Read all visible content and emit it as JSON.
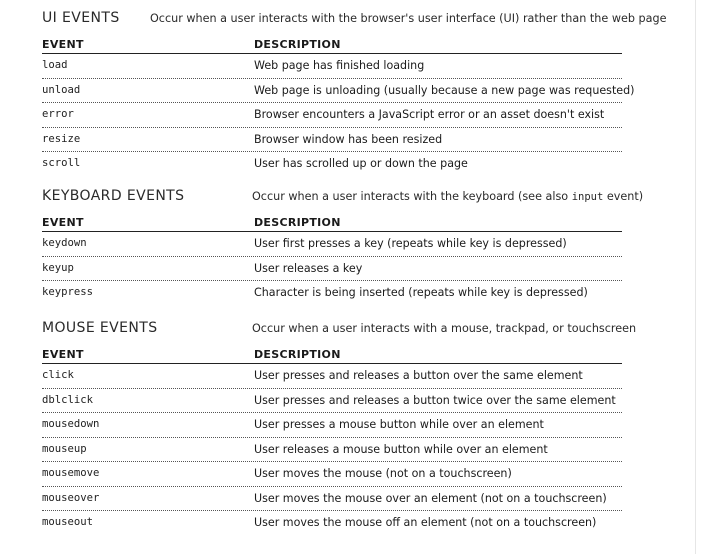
{
  "column_headers": {
    "event": "EVENT",
    "description": "DESCRIPTION"
  },
  "ui_events": {
    "title": "UI EVENTS",
    "description": "Occur when a user interacts with the browser's user interface (UI) rather than the web page",
    "rows": [
      {
        "event": "load",
        "description": "Web page has finished loading"
      },
      {
        "event": "unload",
        "description": "Web page is unloading (usually because a new page was requested)"
      },
      {
        "event": "error",
        "description": "Browser encounters a JavaScript error or an asset doesn't exist"
      },
      {
        "event": "resize",
        "description": "Browser window has been resized"
      },
      {
        "event": "scroll",
        "description": "User has scrolled up or down the page"
      }
    ]
  },
  "keyboard_events": {
    "title": "KEYBOARD EVENTS",
    "description_before": "Occur when a user interacts with the keyboard (see also ",
    "description_code": "input",
    "description_after": " event)",
    "rows": [
      {
        "event": "keydown",
        "description": "User first presses a key (repeats while key is depressed)"
      },
      {
        "event": "keyup",
        "description": "User releases a key"
      },
      {
        "event": "keypress",
        "description": "Character is being inserted (repeats while key is depressed)"
      }
    ]
  },
  "mouse_events": {
    "title": "MOUSE EVENTS",
    "description": "Occur when a user interacts with a mouse, trackpad, or touchscreen",
    "rows": [
      {
        "event": "click",
        "description": "User presses and releases a button over the same element"
      },
      {
        "event": "dblclick",
        "description": "User presses and releases a button twice over the same element"
      },
      {
        "event": "mousedown",
        "description": "User presses a mouse button while over an element"
      },
      {
        "event": "mouseup",
        "description": "User releases a mouse button while over an element"
      },
      {
        "event": "mousemove",
        "description": "User moves the mouse (not on a touchscreen)"
      },
      {
        "event": "mouseover",
        "description": "User moves the mouse over an element (not on a touchscreen)"
      },
      {
        "event": "mouseout",
        "description": "User moves the mouse off an element (not on a touchscreen)"
      }
    ]
  }
}
